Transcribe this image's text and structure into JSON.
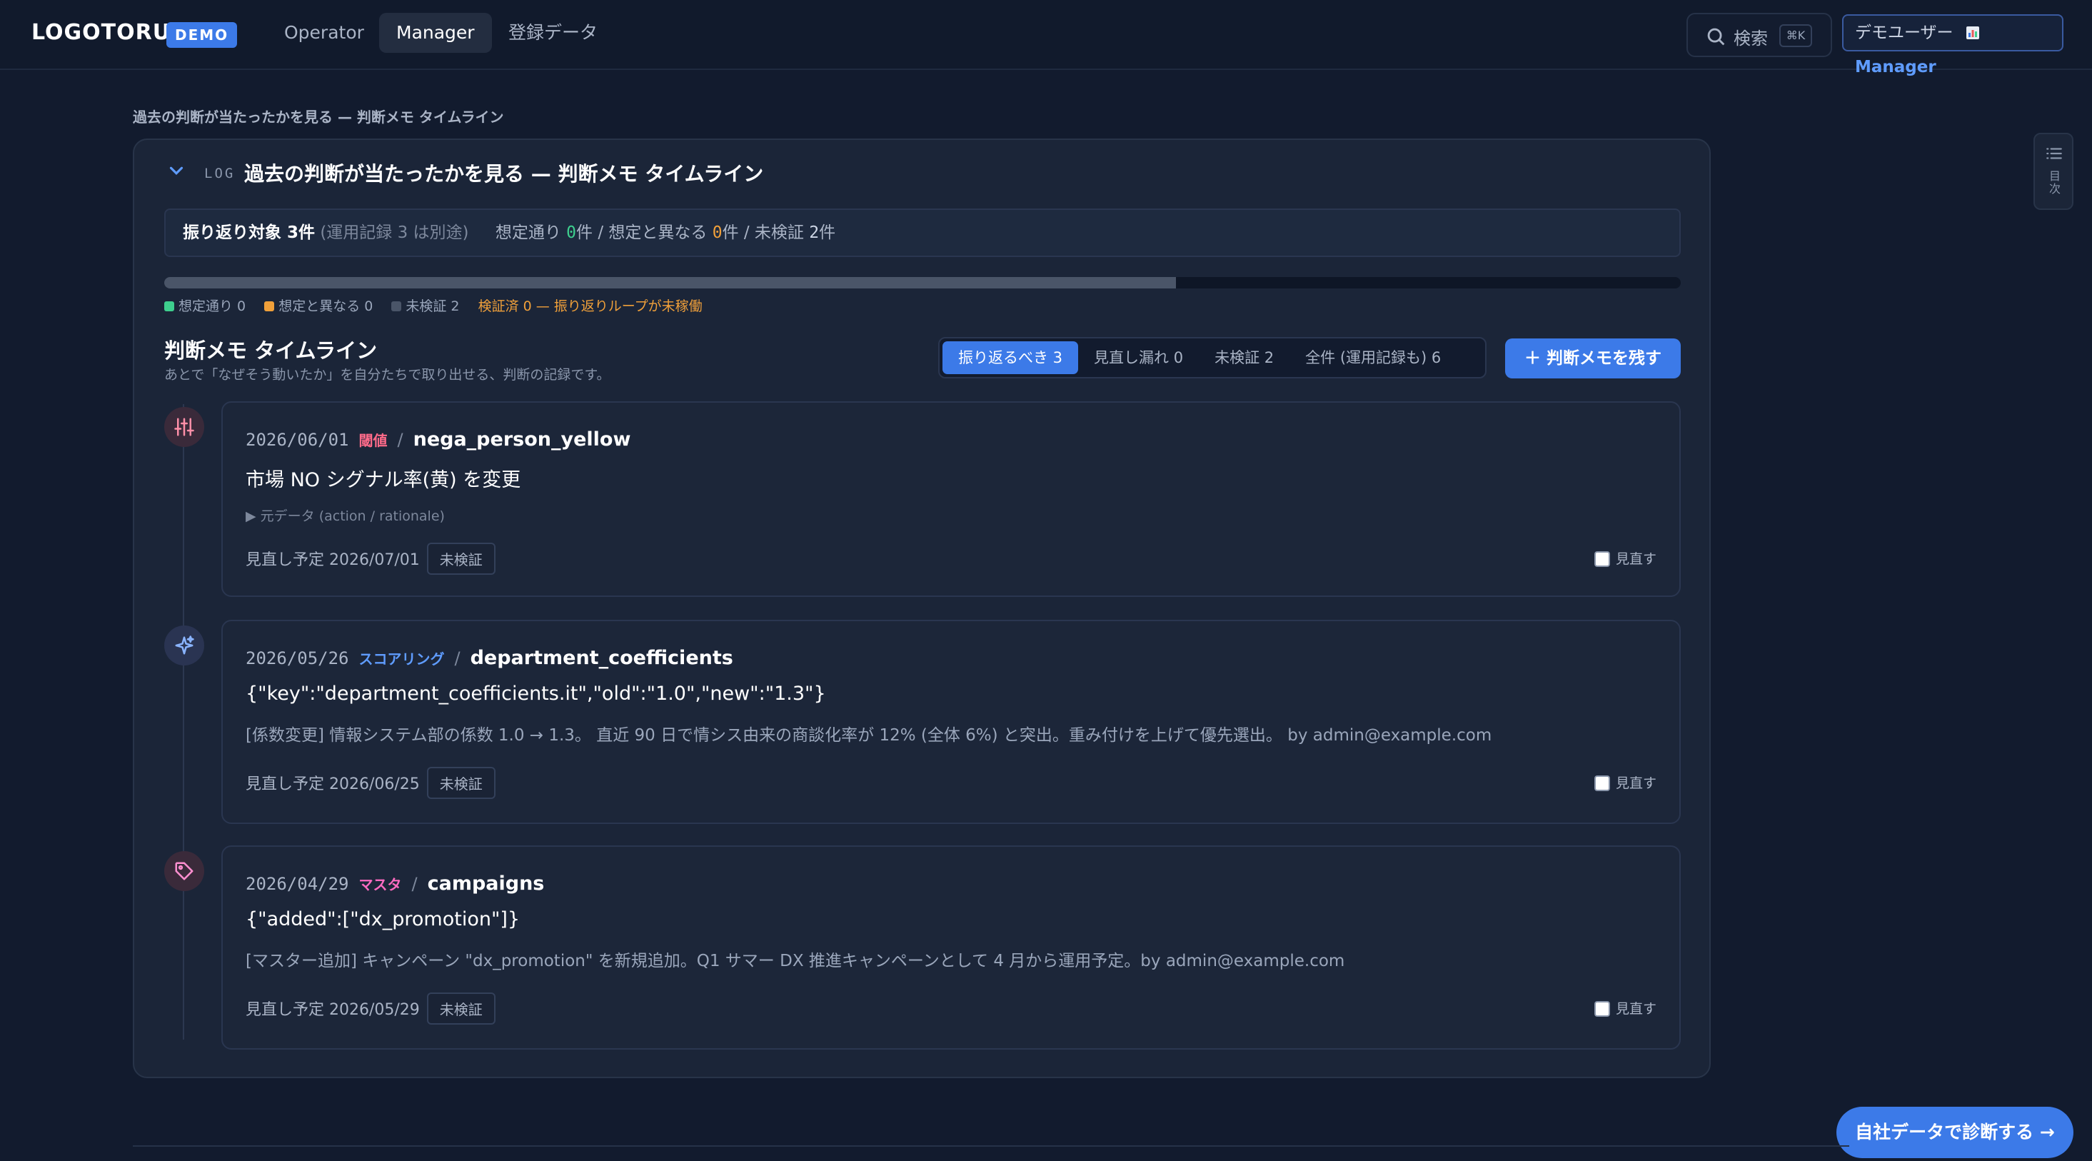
{
  "header": {
    "logo": "LOGOTORU",
    "demo_badge": "DEMO",
    "nav": [
      "Operator",
      "Manager",
      "登録データ"
    ],
    "active_nav": "Manager",
    "search_label": "検索",
    "search_shortcut": "⌘K",
    "user_name": "デモユーザー",
    "user_role_icon": "chart-icon",
    "user_role": "Manager"
  },
  "breadcrumb": "過去の判断が当たったかを見る — 判断メモ タイムライン",
  "panel": {
    "log_tag": "LOG",
    "title": "過去の判断が当たったかを見る — 判断メモ タイムライン",
    "summary": {
      "target_label": "振り返り対象 3件",
      "ops_note": "(運用記録 3 は別途)",
      "as_expected_prefix": "想定通り ",
      "as_expected_count": "0",
      "as_expected_suffix": "件 / 想定と異なる ",
      "different_count": "0",
      "different_suffix": "件 / 未検証 ",
      "unverified_count": "2",
      "unverified_suffix": "件"
    },
    "progress": {
      "filled_fraction": 0.667,
      "fill_color": "#4a5568"
    },
    "legend": {
      "as_expected": "想定通り 0",
      "different": "想定と異なる 0",
      "unverified": "未検証 2",
      "warning": "検証済 0 — 振り返りループが未稼働",
      "colors": {
        "as_expected": "#3ecf8e",
        "different": "#f0a03a",
        "unverified": "#4a5568"
      }
    }
  },
  "timeline": {
    "title": "判断メモ タイムライン",
    "subtitle": "あとで「なぜそう動いたか」を自分たちで取り出せる、判断の記録です。",
    "tabs": [
      "振り返るべき 3",
      "見直し漏れ 0",
      "未検証 2",
      "全件 (運用記録も) 6"
    ],
    "active_tab": "振り返るべき 3",
    "add_button": "＋ 判断メモを残す",
    "cards": [
      {
        "icon": "sliders-icon",
        "date": "2026/06/01",
        "category": "閾値",
        "category_color": "#ff6b8a",
        "target": "nega_person_yellow",
        "summary": "市場 NO シグナル率(黄) を変更",
        "detail": "▶ 元データ (action / rationale)",
        "body": "",
        "review_label": "見直し予定 2026/07/01",
        "status": "未検証",
        "checkbox_label": "見直す"
      },
      {
        "icon": "sparkle-icon",
        "date": "2026/05/26",
        "category": "スコアリング",
        "category_color": "#5f9cff",
        "target": "department_coefficients",
        "summary": "{\"key\":\"department_coefficients.it\",\"old\":\"1.0\",\"new\":\"1.3\"}",
        "detail": "",
        "body": "[係数変更] 情報システム部の係数 1.0 → 1.3。 直近 90 日で情シス由来の商談化率が 12% (全体 6%) と突出。重み付けを上げて優先選出。 by admin@example.com",
        "review_label": "見直し予定 2026/06/25",
        "status": "未検証",
        "checkbox_label": "見直す"
      },
      {
        "icon": "tag-icon",
        "date": "2026/04/29",
        "category": "マスタ",
        "category_color": "#ff6bc1",
        "target": "campaigns",
        "summary": "{\"added\":[\"dx_promotion\"]}",
        "detail": "",
        "body": "[マスター追加] キャンペーン \"dx_promotion\" を新規追加。Q1 サマー DX 推進キャンペーンとして 4 月から運用予定。by admin@example.com",
        "review_label": "見直し予定 2026/05/29",
        "status": "未検証",
        "checkbox_label": "見直す"
      }
    ]
  },
  "toc_label": "目次",
  "cta_button": "自社データで診断する →"
}
